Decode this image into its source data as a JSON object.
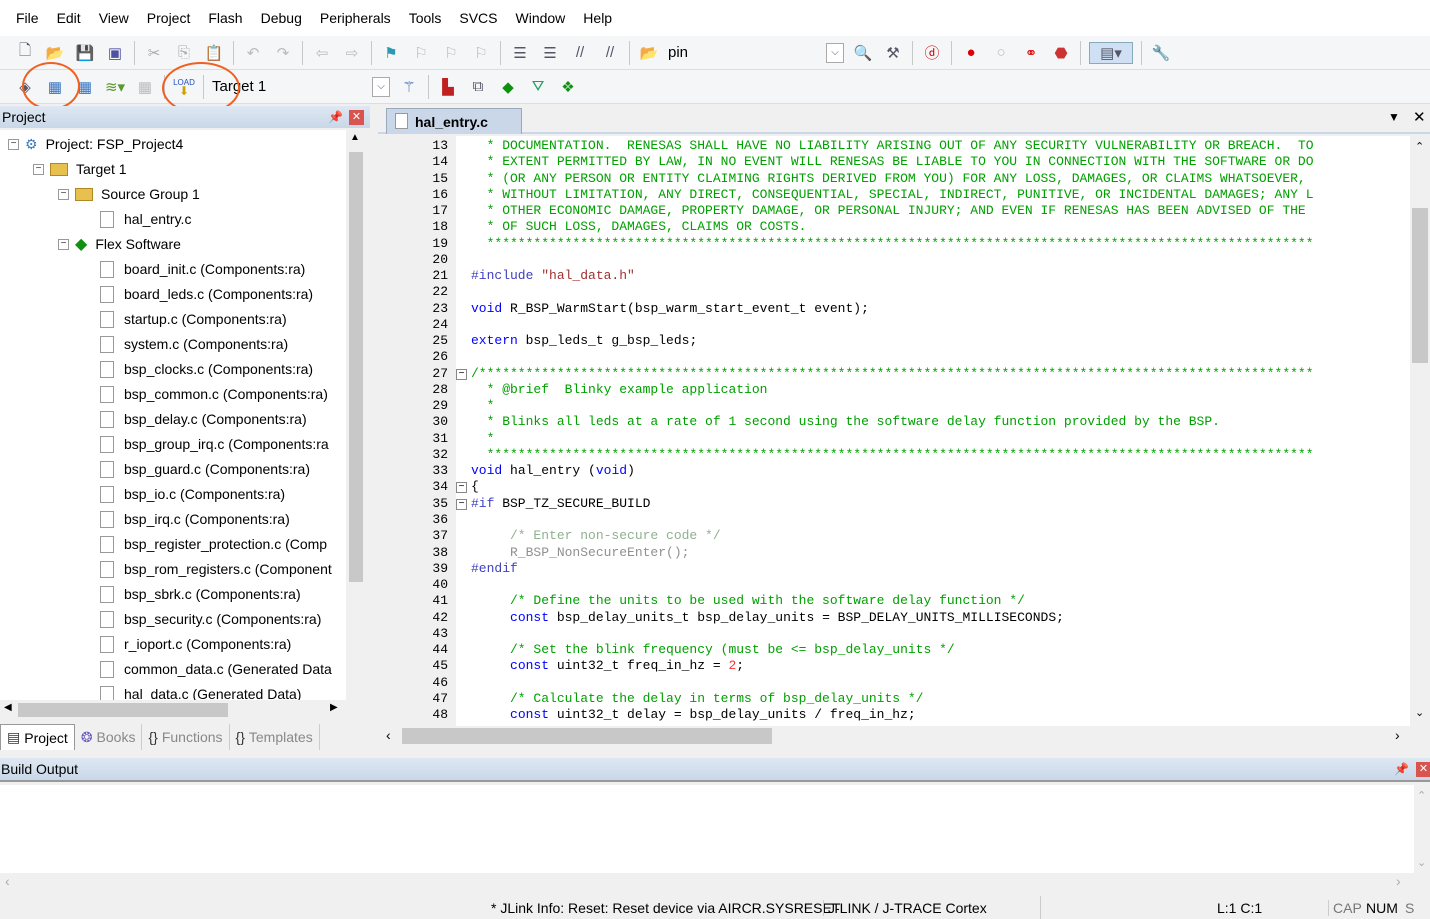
{
  "menu": [
    "File",
    "Edit",
    "View",
    "Project",
    "Flash",
    "Debug",
    "Peripherals",
    "Tools",
    "SVCS",
    "Window",
    "Help"
  ],
  "toolbar": {
    "find_value": "pin",
    "target": "Target 1",
    "load_label": "LOAD"
  },
  "project_panel": {
    "title": "Project",
    "tree": [
      {
        "label": "Project: FSP_Project4",
        "level": 0,
        "type": "project"
      },
      {
        "label": "Target 1",
        "level": 1,
        "type": "target"
      },
      {
        "label": "Source Group 1",
        "level": 2,
        "type": "folder"
      },
      {
        "label": "hal_entry.c",
        "level": 3,
        "type": "file"
      },
      {
        "label": "Flex Software",
        "level": 2,
        "type": "component"
      },
      {
        "label": "board_init.c (Components:ra)",
        "level": 3,
        "type": "file"
      },
      {
        "label": "board_leds.c (Components:ra)",
        "level": 3,
        "type": "file"
      },
      {
        "label": "startup.c (Components:ra)",
        "level": 3,
        "type": "file"
      },
      {
        "label": "system.c (Components:ra)",
        "level": 3,
        "type": "file"
      },
      {
        "label": "bsp_clocks.c (Components:ra)",
        "level": 3,
        "type": "file"
      },
      {
        "label": "bsp_common.c (Components:ra)",
        "level": 3,
        "type": "file"
      },
      {
        "label": "bsp_delay.c (Components:ra)",
        "level": 3,
        "type": "file"
      },
      {
        "label": "bsp_group_irq.c (Components:ra",
        "level": 3,
        "type": "file"
      },
      {
        "label": "bsp_guard.c (Components:ra)",
        "level": 3,
        "type": "file"
      },
      {
        "label": "bsp_io.c (Components:ra)",
        "level": 3,
        "type": "file"
      },
      {
        "label": "bsp_irq.c (Components:ra)",
        "level": 3,
        "type": "file"
      },
      {
        "label": "bsp_register_protection.c (Comp",
        "level": 3,
        "type": "file"
      },
      {
        "label": "bsp_rom_registers.c (Component",
        "level": 3,
        "type": "file"
      },
      {
        "label": "bsp_sbrk.c (Components:ra)",
        "level": 3,
        "type": "file"
      },
      {
        "label": "bsp_security.c (Components:ra)",
        "level": 3,
        "type": "file"
      },
      {
        "label": "r_ioport.c (Components:ra)",
        "level": 3,
        "type": "file"
      },
      {
        "label": "common_data.c (Generated Data",
        "level": 3,
        "type": "file"
      },
      {
        "label": "hal_data.c (Generated Data)",
        "level": 3,
        "type": "file"
      }
    ],
    "tabs": [
      "Project",
      "Books",
      "Functions",
      "Templates"
    ]
  },
  "editor": {
    "tab": "hal_entry.c",
    "lines": [
      {
        "n": 13,
        "segs": [
          {
            "t": "  * DOCUMENTATION.  RENESAS SHALL HAVE NO LIABILITY ARISING OUT OF ANY SECURITY VULNERABILITY OR BREACH.  TO",
            "c": "g"
          }
        ]
      },
      {
        "n": 14,
        "segs": [
          {
            "t": "  * EXTENT PERMITTED BY LAW, IN NO EVENT WILL RENESAS BE LIABLE TO YOU IN CONNECTION WITH THE SOFTWARE OR DO",
            "c": "g"
          }
        ]
      },
      {
        "n": 15,
        "segs": [
          {
            "t": "  * (OR ANY PERSON OR ENTITY CLAIMING RIGHTS DERIVED FROM YOU) FOR ANY LOSS, DAMAGES, OR CLAIMS WHATSOEVER,",
            "c": "g"
          }
        ]
      },
      {
        "n": 16,
        "segs": [
          {
            "t": "  * WITHOUT LIMITATION, ANY DIRECT, CONSEQUENTIAL, SPECIAL, INDIRECT, PUNITIVE, OR INCIDENTAL DAMAGES; ANY L",
            "c": "g"
          }
        ]
      },
      {
        "n": 17,
        "segs": [
          {
            "t": "  * OTHER ECONOMIC DAMAGE, PROPERTY DAMAGE, OR PERSONAL INJURY; AND EVEN IF RENESAS HAS BEEN ADVISED OF THE",
            "c": "g"
          }
        ]
      },
      {
        "n": 18,
        "segs": [
          {
            "t": "  * OF SUCH LOSS, DAMAGES, CLAIMS OR COSTS.",
            "c": "g"
          }
        ]
      },
      {
        "n": 19,
        "segs": [
          {
            "t": "  **********************************************************************************************************",
            "c": "g"
          }
        ]
      },
      {
        "n": 20,
        "segs": []
      },
      {
        "n": 21,
        "segs": [
          {
            "t": "#include ",
            "c": "p"
          },
          {
            "t": "\"hal_data.h\"",
            "c": "s"
          }
        ]
      },
      {
        "n": 22,
        "segs": []
      },
      {
        "n": 23,
        "segs": [
          {
            "t": "void",
            "c": "b"
          },
          {
            "t": " R_BSP_WarmStart(bsp_warm_start_event_t event);",
            "c": "k"
          }
        ]
      },
      {
        "n": 24,
        "segs": []
      },
      {
        "n": 25,
        "segs": [
          {
            "t": "extern",
            "c": "b"
          },
          {
            "t": " bsp_leds_t g_bsp_leds;",
            "c": "k"
          }
        ]
      },
      {
        "n": 26,
        "segs": []
      },
      {
        "n": 27,
        "segs": [
          {
            "t": "/***********************************************************************************************************",
            "c": "g"
          }
        ]
      },
      {
        "n": 28,
        "segs": [
          {
            "t": "  * @brief  Blinky example application",
            "c": "g"
          }
        ]
      },
      {
        "n": 29,
        "segs": [
          {
            "t": "  *",
            "c": "g"
          }
        ]
      },
      {
        "n": 30,
        "segs": [
          {
            "t": "  * Blinks all leds at a rate of 1 second using the software delay function provided by the BSP.",
            "c": "g"
          }
        ]
      },
      {
        "n": 31,
        "segs": [
          {
            "t": "  *",
            "c": "g"
          }
        ]
      },
      {
        "n": 32,
        "segs": [
          {
            "t": "  **********************************************************************************************************",
            "c": "g"
          }
        ]
      },
      {
        "n": 33,
        "segs": [
          {
            "t": "void",
            "c": "b"
          },
          {
            "t": " hal_entry (",
            "c": "k"
          },
          {
            "t": "void",
            "c": "b"
          },
          {
            "t": ")",
            "c": "k"
          }
        ]
      },
      {
        "n": 34,
        "segs": [
          {
            "t": "{",
            "c": "k"
          }
        ]
      },
      {
        "n": 35,
        "segs": [
          {
            "t": "#if",
            "c": "p"
          },
          {
            "t": " BSP_TZ_SECURE_BUILD",
            "c": "k"
          }
        ]
      },
      {
        "n": 36,
        "segs": []
      },
      {
        "n": 37,
        "segs": [
          {
            "t": "     /* Enter non-secure code */",
            "c": "gc"
          }
        ]
      },
      {
        "n": 38,
        "segs": [
          {
            "t": "     R_BSP_NonSecureEnter();",
            "c": "gr"
          }
        ]
      },
      {
        "n": 39,
        "segs": [
          {
            "t": "#endif",
            "c": "p"
          }
        ]
      },
      {
        "n": 40,
        "segs": []
      },
      {
        "n": 41,
        "segs": [
          {
            "t": "     /* Define the units to be used with the software delay function */",
            "c": "g"
          }
        ]
      },
      {
        "n": 42,
        "segs": [
          {
            "t": "     ",
            "c": "k"
          },
          {
            "t": "const",
            "c": "b"
          },
          {
            "t": " bsp_delay_units_t bsp_delay_units = BSP_DELAY_UNITS_MILLISECONDS;",
            "c": "k"
          }
        ]
      },
      {
        "n": 43,
        "segs": []
      },
      {
        "n": 44,
        "segs": [
          {
            "t": "     /* Set the blink frequency (must be <= bsp_delay_units */",
            "c": "g"
          }
        ]
      },
      {
        "n": 45,
        "segs": [
          {
            "t": "     ",
            "c": "k"
          },
          {
            "t": "const",
            "c": "b"
          },
          {
            "t": " uint32_t freq_in_hz = ",
            "c": "k"
          },
          {
            "t": "2",
            "c": "d"
          },
          {
            "t": ";",
            "c": "k"
          }
        ]
      },
      {
        "n": 46,
        "segs": []
      },
      {
        "n": 47,
        "segs": [
          {
            "t": "     /* Calculate the delay in terms of bsp_delay_units */",
            "c": "g"
          }
        ]
      },
      {
        "n": 48,
        "segs": [
          {
            "t": "     ",
            "c": "k"
          },
          {
            "t": "const",
            "c": "b"
          },
          {
            "t": " uint32_t delay = bsp_delay_units / freq_in_hz;",
            "c": "k"
          }
        ]
      }
    ]
  },
  "build_output": {
    "title": "Build Output"
  },
  "status": {
    "message": "* JLink Info: Reset: Reset device via AIRCR.SYSRESET",
    "debugger": "J-LINK / J-TRACE Cortex",
    "position": "L:1 C:1",
    "cap": "CAP",
    "num": "NUM",
    "scrl": "S"
  },
  "colors": {
    "comment": "#00a000",
    "keyword": "#0000ff",
    "annotation": "#f06020",
    "panel_header": "#c9d7e8"
  }
}
